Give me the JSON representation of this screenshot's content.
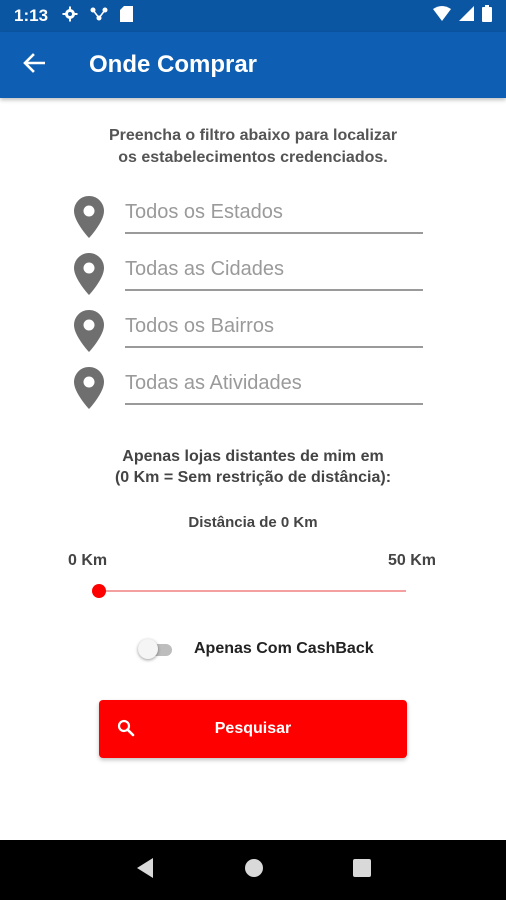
{
  "status_bar": {
    "time": "1:13",
    "icons": [
      "gear-icon",
      "network-icon",
      "sd-card-icon",
      "wifi-icon",
      "signal-icon",
      "battery-icon"
    ]
  },
  "app_bar": {
    "title": "Onde Comprar",
    "back_icon": "arrow-left-icon"
  },
  "intro_text": "Preencha o filtro abaixo para localizar os estabelecimentos credenciados.",
  "filters": [
    {
      "placeholder": "Todos os Estados",
      "icon": "location-pin-icon"
    },
    {
      "placeholder": "Todas as Cidades",
      "icon": "location-pin-icon"
    },
    {
      "placeholder": "Todos os Bairros",
      "icon": "location-pin-icon"
    },
    {
      "placeholder": "Todas as Atividades",
      "icon": "location-pin-icon"
    }
  ],
  "distance": {
    "description_line1": "Apenas lojas distantes de mim em",
    "description_line2": "(0 Km = Sem restrição de distância):",
    "current_label": "Distância de 0 Km",
    "min_label": "0 Km",
    "max_label": "50 Km",
    "value_km": 0,
    "max_km": 50
  },
  "cashback": {
    "label": "Apenas Com CashBack",
    "enabled": false
  },
  "search_button": {
    "label": "Pesquisar",
    "icon": "search-icon"
  },
  "colors": {
    "app_bar": "#0e5fb3",
    "status_bar": "#0b56a3",
    "accent": "#ff0000"
  },
  "nav_bar": {
    "icons": [
      "back-triangle-icon",
      "home-circle-icon",
      "recents-square-icon"
    ]
  }
}
